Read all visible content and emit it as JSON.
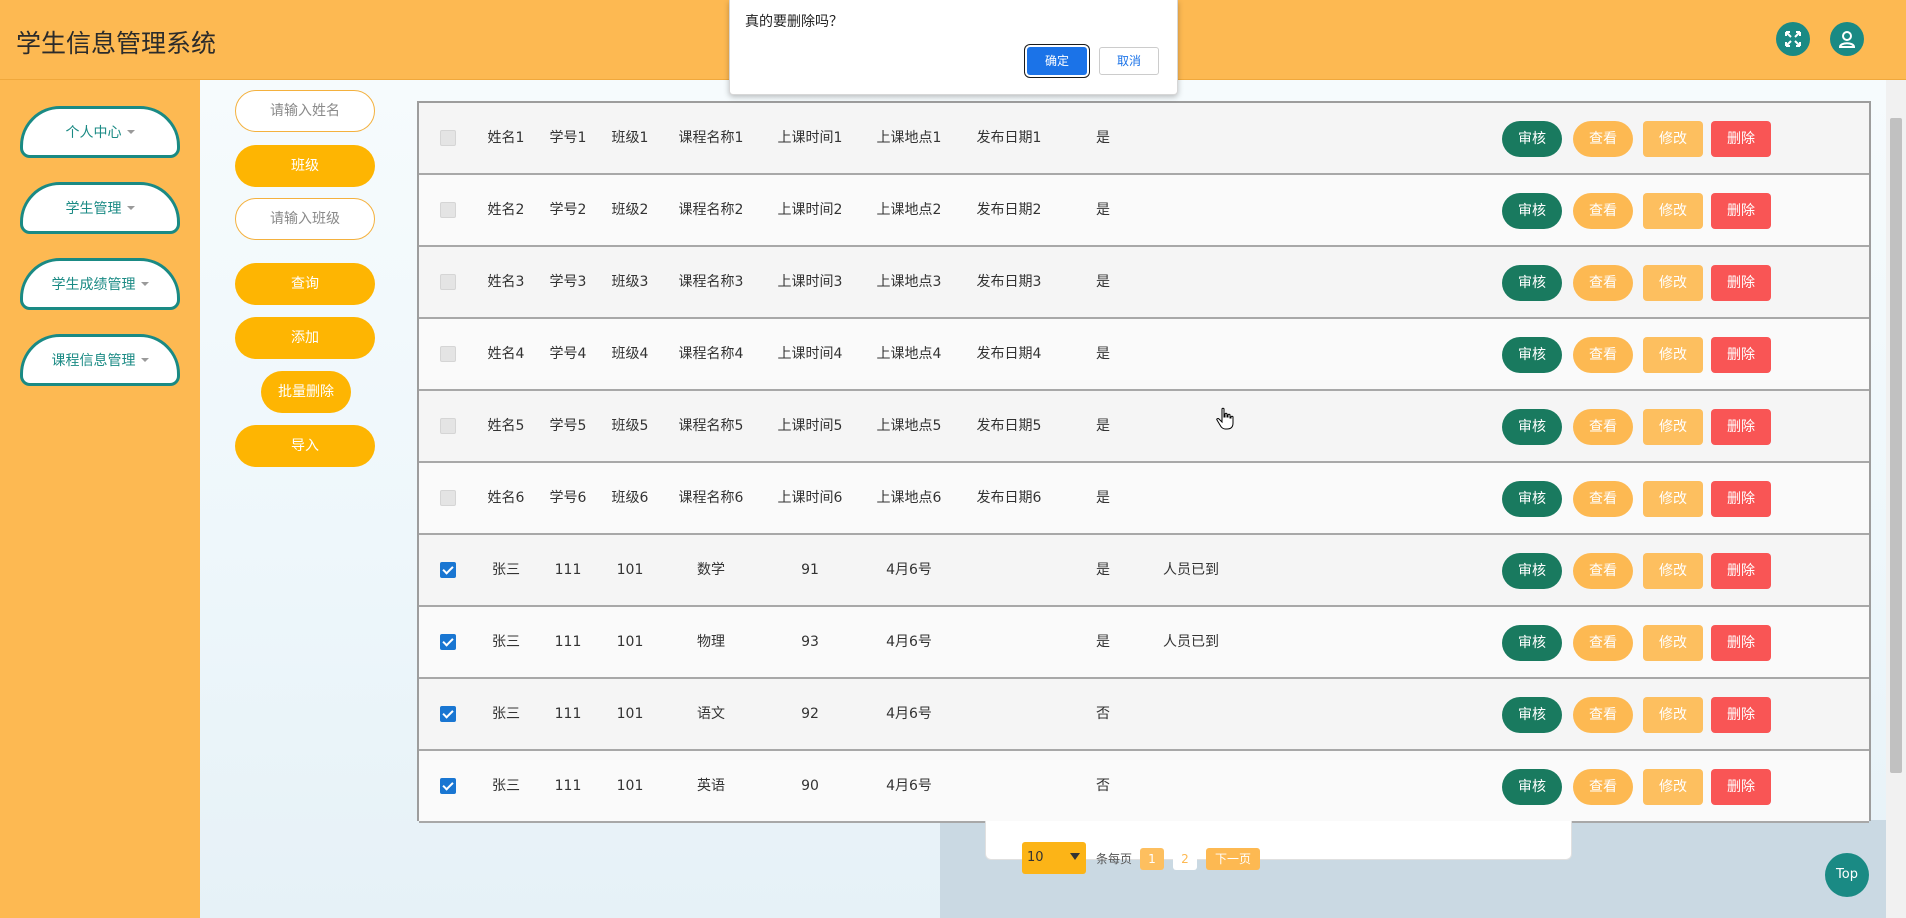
{
  "app": {
    "title": "学生信息管理系统"
  },
  "header": {
    "fullscreen_icon": "fullscreen-icon",
    "user_icon": "user-icon"
  },
  "sidebar": {
    "items": [
      {
        "label": "个人中心"
      },
      {
        "label": "学生管理"
      },
      {
        "label": "学生成绩管理"
      },
      {
        "label": "课程信息管理"
      }
    ]
  },
  "search": {
    "name_placeholder": "请输入姓名",
    "class_label": "班级",
    "class_placeholder": "请输入班级",
    "query_label": "查询",
    "add_label": "添加",
    "batch_delete_label": "批量删除",
    "import_label": "导入"
  },
  "table": {
    "rows": [
      {
        "checked": false,
        "name": "姓名1",
        "id": "学号1",
        "class": "班级1",
        "course": "课程名称1",
        "time": "上课时间1",
        "place": "上课地点1",
        "date": "发布日期1",
        "flag": "是",
        "note": ""
      },
      {
        "checked": false,
        "name": "姓名2",
        "id": "学号2",
        "class": "班级2",
        "course": "课程名称2",
        "time": "上课时间2",
        "place": "上课地点2",
        "date": "发布日期2",
        "flag": "是",
        "note": ""
      },
      {
        "checked": false,
        "name": "姓名3",
        "id": "学号3",
        "class": "班级3",
        "course": "课程名称3",
        "time": "上课时间3",
        "place": "上课地点3",
        "date": "发布日期3",
        "flag": "是",
        "note": ""
      },
      {
        "checked": false,
        "name": "姓名4",
        "id": "学号4",
        "class": "班级4",
        "course": "课程名称4",
        "time": "上课时间4",
        "place": "上课地点4",
        "date": "发布日期4",
        "flag": "是",
        "note": ""
      },
      {
        "checked": false,
        "name": "姓名5",
        "id": "学号5",
        "class": "班级5",
        "course": "课程名称5",
        "time": "上课时间5",
        "place": "上课地点5",
        "date": "发布日期5",
        "flag": "是",
        "note": ""
      },
      {
        "checked": false,
        "name": "姓名6",
        "id": "学号6",
        "class": "班级6",
        "course": "课程名称6",
        "time": "上课时间6",
        "place": "上课地点6",
        "date": "发布日期6",
        "flag": "是",
        "note": ""
      },
      {
        "checked": true,
        "name": "张三",
        "id": "111",
        "class": "101",
        "course": "数学",
        "time": "91",
        "place": "4月6号",
        "date": "",
        "flag": "是",
        "note": "人员已到"
      },
      {
        "checked": true,
        "name": "张三",
        "id": "111",
        "class": "101",
        "course": "物理",
        "time": "93",
        "place": "4月6号",
        "date": "",
        "flag": "是",
        "note": "人员已到"
      },
      {
        "checked": true,
        "name": "张三",
        "id": "111",
        "class": "101",
        "course": "语文",
        "time": "92",
        "place": "4月6号",
        "date": "",
        "flag": "否",
        "note": ""
      },
      {
        "checked": true,
        "name": "张三",
        "id": "111",
        "class": "101",
        "course": "英语",
        "time": "90",
        "place": "4月6号",
        "date": "",
        "flag": "否",
        "note": ""
      }
    ],
    "actions": {
      "review": "审核",
      "view": "查看",
      "edit": "修改",
      "delete": "删除"
    }
  },
  "pagination": {
    "page_size": "10",
    "per_page_label": "条每页",
    "pages": [
      "1",
      "2"
    ],
    "current_page": "1",
    "next_label": "下一页"
  },
  "top_button": {
    "label": "Top"
  },
  "dialog": {
    "message": "真的要删除吗？",
    "confirm_label": "确定",
    "cancel_label": "取消"
  },
  "colors": {
    "header": "#fdb952",
    "accent_teal": "#1a8a84",
    "button_yellow": "#feb502",
    "review": "#197a5f",
    "delete": "#f95555",
    "dialog_ok": "#1b73e8"
  }
}
